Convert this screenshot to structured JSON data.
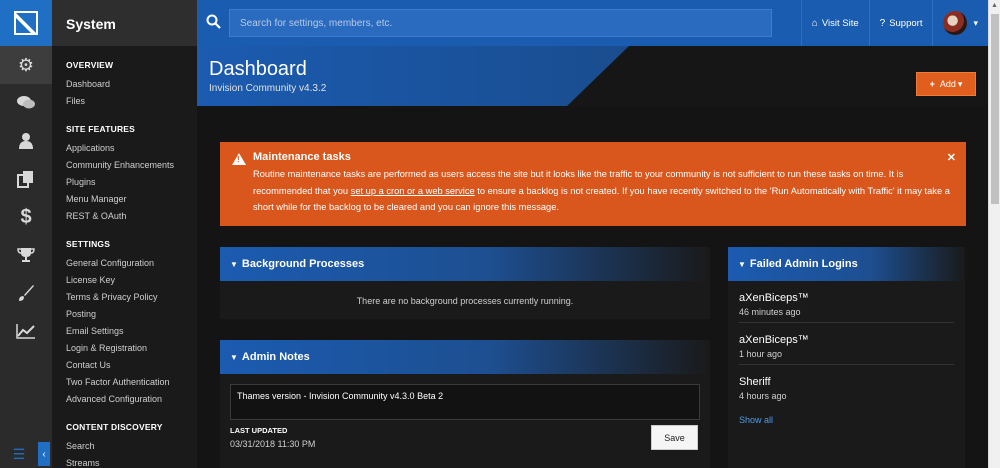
{
  "sidebar": {
    "title": "System",
    "sections": [
      {
        "heading": "OVERVIEW",
        "items": [
          "Dashboard",
          "Files"
        ]
      },
      {
        "heading": "SITE FEATURES",
        "items": [
          "Applications",
          "Community Enhancements",
          "Plugins",
          "Menu Manager",
          "REST & OAuth"
        ]
      },
      {
        "heading": "SETTINGS",
        "items": [
          "General Configuration",
          "License Key",
          "Terms & Privacy Policy",
          "Posting",
          "Email Settings",
          "Login & Registration",
          "Contact Us",
          "Two Factor Authentication",
          "Advanced Configuration"
        ]
      },
      {
        "heading": "CONTENT DISCOVERY",
        "items": [
          "Search",
          "Streams"
        ]
      }
    ]
  },
  "topbar": {
    "search_placeholder": "Search for settings, members, etc.",
    "visit_site": "Visit Site",
    "support": "Support"
  },
  "header": {
    "title": "Dashboard",
    "version": "Invision Community v4.3.2",
    "add_label": "Add"
  },
  "alert": {
    "title": "Maintenance tasks",
    "text_1": "Routine maintenance tasks are performed as users access the site but it looks like the traffic to your community is not sufficient to run these tasks on time. It is recommended that you ",
    "link": "set up a cron or a web service",
    "text_2": " to ensure a backlog is not created. If you have recently switched to the 'Run Automatically with Traffic' it may take a short while for the backlog to be cleared and you can ignore this message."
  },
  "background_processes": {
    "title": "Background Processes",
    "empty": "There are no background processes currently running."
  },
  "admin_notes": {
    "title": "Admin Notes",
    "note": "Thames version - Invision Community v4.3.0 Beta 2",
    "last_updated_label": "LAST UPDATED",
    "last_updated": "03/31/2018 11:30 PM",
    "save_label": "Save"
  },
  "failed_logins": {
    "title": "Failed Admin Logins",
    "items": [
      {
        "name": "aXenBiceps™",
        "time": "46 minutes ago"
      },
      {
        "name": "aXenBiceps™",
        "time": "1 hour ago"
      },
      {
        "name": "Sheriff",
        "time": "4 hours ago"
      }
    ],
    "show_all": "Show all"
  }
}
